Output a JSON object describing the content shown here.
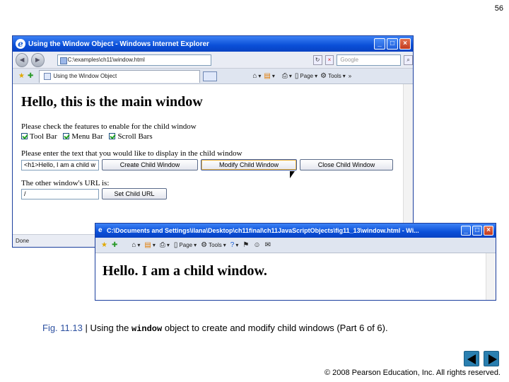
{
  "slide": {
    "page_number": "56",
    "caption_prefix": "Fig. 11.13",
    "caption_sep": " | Using the ",
    "caption_code": "window",
    "caption_suffix": " object to create and modify child windows (Part 6 of 6).",
    "copyright": "© 2008 Pearson Education, Inc. All rights reserved."
  },
  "main_window": {
    "title": "Using the Window Object - Windows Internet Explorer",
    "address": "C:\\examples\\ch11\\window.html",
    "search_placeholder": "Google",
    "tab_label": "Using the Window Object",
    "toolbar": {
      "page": "Page",
      "tools": "Tools",
      "more": "»"
    },
    "heading": "Hello, this is the main window",
    "features_prompt": "Please check the features to enable for the child window",
    "checkboxes": [
      "Tool Bar",
      "Menu Bar",
      "Scroll Bars"
    ],
    "text_prompt": "Please enter the text that you would like to display in the child window",
    "text_value": "<h1>Hello, I am a child w",
    "buttons": {
      "create": "Create Child Window",
      "modify": "Modify Child Window",
      "close": "Close Child Window",
      "set_url": "Set Child URL"
    },
    "url_prompt": "The other window's URL is:",
    "url_value": "/",
    "status": "Done"
  },
  "child_window": {
    "title": "C:\\Documents and Settings\\ilana\\Desktop\\ch11final\\ch11JavaScriptObjects\\fig11_13\\window.html - Wi...",
    "toolbar": {
      "page": "Page",
      "tools": "Tools"
    },
    "heading": "Hello. I am a child window."
  },
  "colors": {
    "titlebar": "#0a4fd8",
    "nav_arrow": "#2a7fb0",
    "caption_fig": "#2c50a0"
  }
}
